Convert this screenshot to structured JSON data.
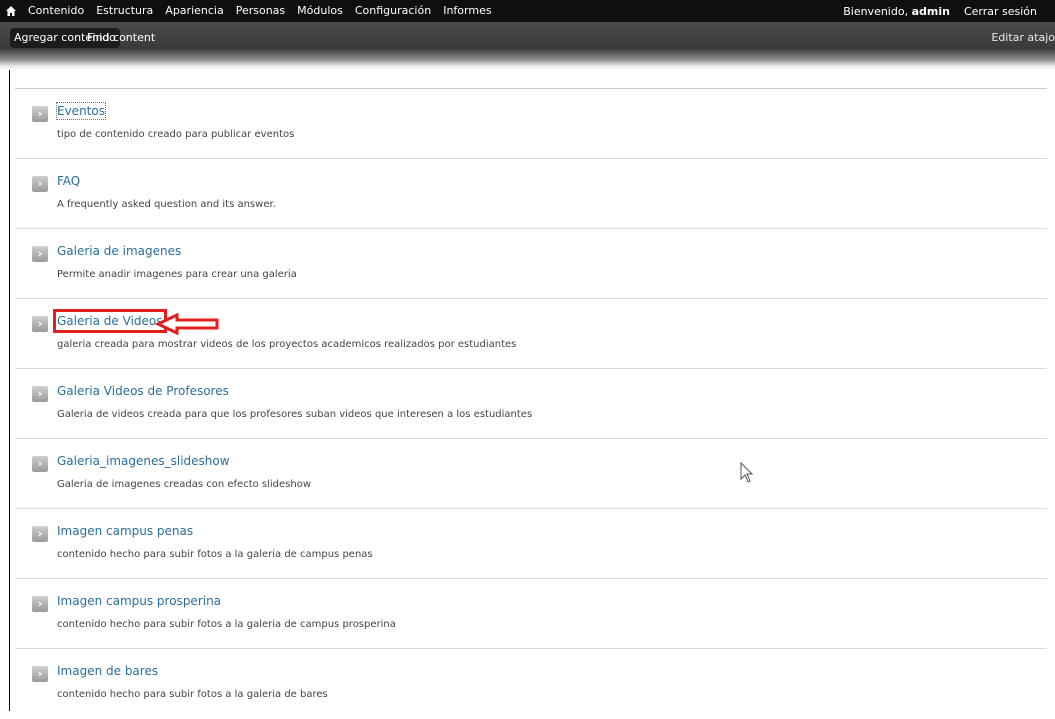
{
  "toolbar": {
    "home_icon": "home-icon",
    "menu": [
      "Contenido",
      "Estructura",
      "Apariencia",
      "Personas",
      "Módulos",
      "Configuración",
      "Informes"
    ],
    "welcome_prefix": "Bienvenido,",
    "username": "admin",
    "logout": "Cerrar sesión"
  },
  "shortcuts": {
    "items": [
      "Agregar contenido",
      "Find content"
    ],
    "edit_label": "Editar atajo"
  },
  "content_types": [
    {
      "title": "Eventos",
      "description": "tipo de contenido creado para publicar eventos"
    },
    {
      "title": "FAQ",
      "description": "A frequently asked question and its answer."
    },
    {
      "title": "Galeria de imagenes",
      "description": "Permite anadir imagenes para crear una galeria"
    },
    {
      "title": "Galeria de Videos",
      "description": "galeria creada para mostrar videos de los proyectos academicos realizados por estudiantes"
    },
    {
      "title": "Galeria Videos de Profesores",
      "description": "Galeria de videos creada para que los profesores suban videos que interesen a los estudiantes"
    },
    {
      "title": "Galeria_imagenes_slideshow",
      "description": "Galeria de imagenes creadas con efecto slideshow"
    },
    {
      "title": "Imagen campus penas",
      "description": "contenido hecho para subir fotos a la galeria de campus penas"
    },
    {
      "title": "Imagen campus prosperina",
      "description": "contenido hecho para subir fotos a la galeria de campus prosperina"
    },
    {
      "title": "Imagen de bares",
      "description": "contenido hecho para subir fotos a la galeria de bares"
    }
  ],
  "colors": {
    "toolbar_bg": "#0f0f0f",
    "link": "#2a6f99",
    "highlight": "#e01f1f"
  }
}
